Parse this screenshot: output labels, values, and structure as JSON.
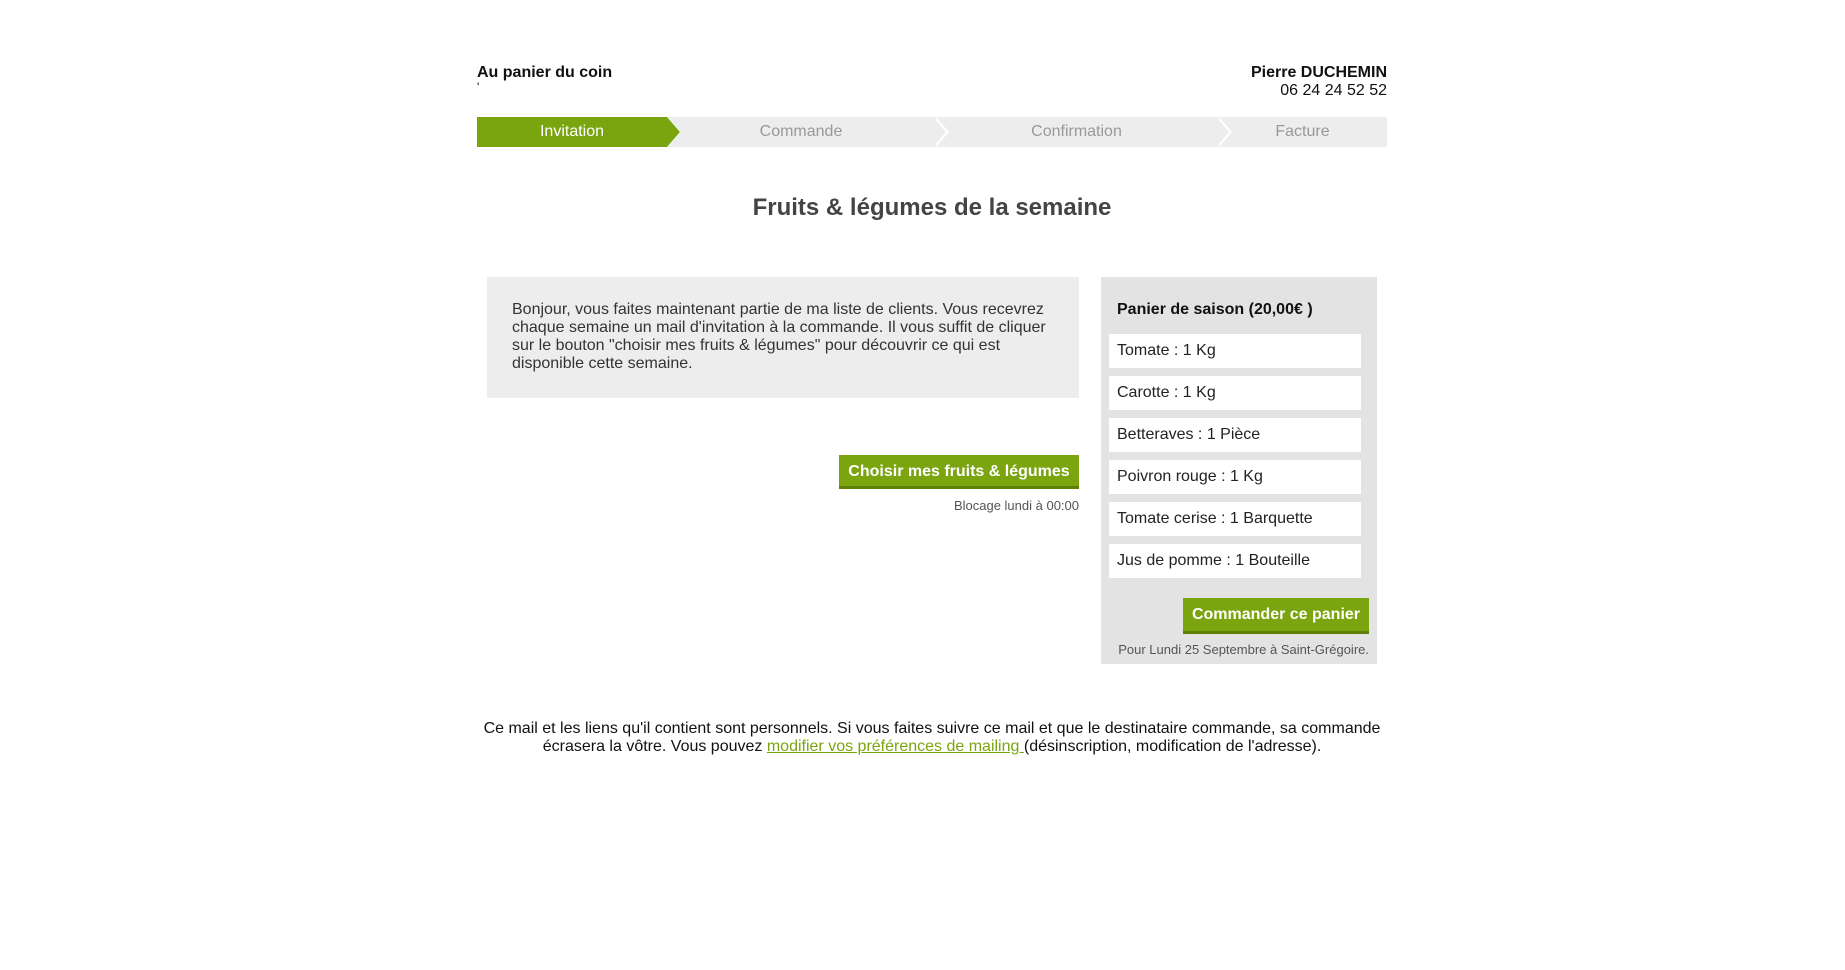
{
  "header": {
    "shop_name": "Au panier du coin",
    "shop_sub": "'",
    "producer_name": "Pierre DUCHEMIN",
    "producer_phone": "06 24 24 52 52"
  },
  "steps": [
    {
      "label": "Invitation",
      "active": true
    },
    {
      "label": "Commande",
      "active": false
    },
    {
      "label": "Confirmation",
      "active": false
    },
    {
      "label": "Facture",
      "active": false
    }
  ],
  "page_title": "Fruits & légumes de la semaine",
  "intro_text": "Bonjour, vous faites maintenant partie de ma liste de clients. Vous recevrez chaque semaine un mail d'invitation à la commande. Il vous suffit de cliquer sur le bouton \"choisir mes fruits & légumes\" pour découvrir ce qui est disponible cette semaine.",
  "choose_button": "Choisir mes fruits & légumes",
  "blocking_text": "Blocage lundi à 00:00",
  "basket": {
    "title": "Panier de saison (20,00€ )",
    "items": [
      "Tomate : 1 Kg",
      "Carotte : 1 Kg",
      "Betteraves : 1 Pièce",
      "Poivron rouge : 1 Kg",
      "Tomate cerise : 1 Barquette",
      "Jus de pomme : 1 Bouteille"
    ],
    "order_button": "Commander ce panier",
    "order_note": "Pour Lundi 25 Septembre à Saint-Grégoire."
  },
  "footer": {
    "text_before": "Ce mail et les liens qu'il contient sont personnels. Si vous faites suivre ce mail et que le destinataire commande, sa commande écrasera la vôtre. Vous pouvez ",
    "link_text": "modifier vos préférences de mailing ",
    "text_after": "(désinscription, modification de l'adresse)."
  },
  "colors": {
    "accent": "#7aa50f",
    "panel_bg": "#ededed",
    "basket_bg": "#e3e3e3"
  }
}
